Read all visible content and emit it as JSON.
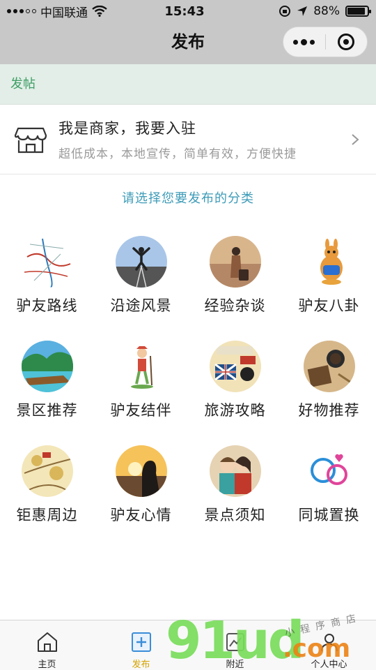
{
  "status_bar": {
    "carrier": "中国联通",
    "time": "15:43",
    "battery": "88%",
    "battery_level": 0.88
  },
  "nav": {
    "title": "发布"
  },
  "post_header": {
    "label": "发帖"
  },
  "merchant": {
    "title": "我是商家，我要入驻",
    "subtitle": "超低成本，本地宣传，简单有效，方便快捷",
    "icon": "store-icon"
  },
  "prompt": "请选择您要发布的分类",
  "categories": [
    {
      "label": "驴友路线",
      "icon": "route-map-icon",
      "colors": [
        "#ffffff",
        "#c0392b",
        "#2e7ab8"
      ]
    },
    {
      "label": "沿途风景",
      "icon": "jumping-traveler-icon",
      "colors": [
        "#a9c6e8",
        "#555555",
        "#222222"
      ]
    },
    {
      "label": "经验杂谈",
      "icon": "suitcase-woman-icon",
      "colors": [
        "#d9b58c",
        "#8b5a3c",
        "#3a2a22"
      ]
    },
    {
      "label": "驴友八卦",
      "icon": "kangaroo-icon",
      "colors": [
        "#ffffff",
        "#e89a3c",
        "#2a6fd1"
      ]
    },
    {
      "label": "景区推荐",
      "icon": "beach-boat-icon",
      "colors": [
        "#5ab0e0",
        "#2d8a4a",
        "#8b5a2b"
      ]
    },
    {
      "label": "驴友结伴",
      "icon": "cartoon-hiker-icon",
      "colors": [
        "#ffffff",
        "#d14a3a",
        "#6aa84f"
      ]
    },
    {
      "label": "旅游攻略",
      "icon": "travel-collage-icon",
      "colors": [
        "#f1e2b8",
        "#c0392b",
        "#1f4e8a"
      ]
    },
    {
      "label": "好物推荐",
      "icon": "coffee-table-icon",
      "colors": [
        "#d6b78a",
        "#6b4a2b",
        "#2b2b2b"
      ]
    },
    {
      "label": "钜惠周边",
      "icon": "tourist-map-icon",
      "colors": [
        "#f3e6b8",
        "#d9b65a",
        "#8b6b3a"
      ]
    },
    {
      "label": "驴友心情",
      "icon": "sunset-silhouette-icon",
      "colors": [
        "#f6c25a",
        "#6a4a30",
        "#1e1a18"
      ]
    },
    {
      "label": "景点须知",
      "icon": "couple-cartoon-icon",
      "colors": [
        "#e6d3b3",
        "#3aa0a0",
        "#c0392b"
      ]
    },
    {
      "label": "同城置换",
      "icon": "chat-bubbles-icon",
      "colors": [
        "#ffffff",
        "#2a8fd8",
        "#e0459a"
      ]
    }
  ],
  "tab_bar": {
    "tabs": [
      {
        "label": "主页",
        "icon": "home-icon"
      },
      {
        "label": "发布",
        "icon": "add-post-icon"
      },
      {
        "label": "附近",
        "icon": "nearby-icon"
      },
      {
        "label": "个人中心",
        "icon": "user-icon"
      }
    ],
    "active_index": 1,
    "active_color": "#d4a300"
  },
  "watermark": {
    "main": "91ud",
    "suffix": ".com",
    "script": "小 程 序 商 店"
  }
}
